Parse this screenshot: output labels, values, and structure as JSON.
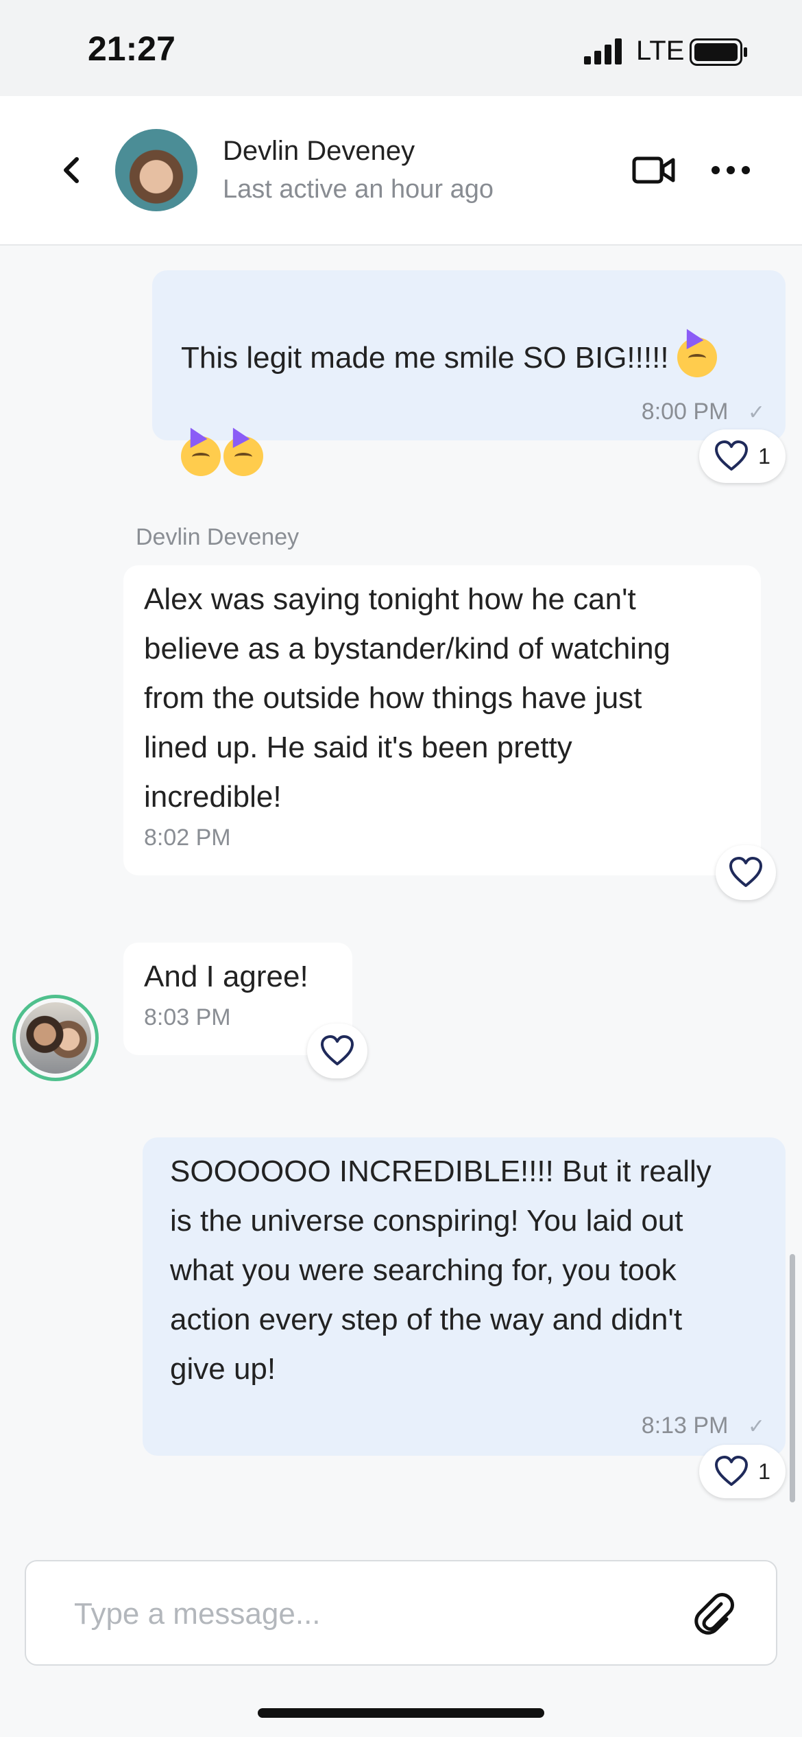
{
  "status_bar": {
    "time": "21:27",
    "network": "LTE"
  },
  "header": {
    "back_icon": "chevron-left-icon",
    "contact_name": "Devlin Deveney",
    "last_active": "Last active an hour ago",
    "video_icon": "video-camera-icon",
    "more_icon": "more-horizontal-icon"
  },
  "messages": [
    {
      "direction": "outgoing",
      "text": "This legit made me smile SO BIG!!!!! ",
      "emoji": "partying-face-emoji",
      "time": "8:00 PM",
      "read_icon": "check-icon",
      "likes": "1"
    },
    {
      "direction": "incoming",
      "sender": "Devlin Deveney",
      "text": "Alex was saying tonight how he can't\nbelieve as a bystander/kind of watching\nfrom the outside how things have just\nlined up. He said it's been pretty\nincredible!",
      "time": "8:02 PM"
    },
    {
      "direction": "incoming",
      "text": "And I agree!",
      "time": "8:03 PM"
    },
    {
      "direction": "outgoing",
      "text": "SOOOOOO INCREDIBLE!!!! But it really\nis the universe conspiring! You laid out\nwhat you were searching for, you took\naction every step of the way and didn't\ngive up!",
      "time": "8:13 PM",
      "read_icon": "check-icon",
      "likes": "1"
    }
  ],
  "composer": {
    "placeholder": "Type a message...",
    "value": "",
    "attach_icon": "paperclip-icon"
  },
  "colors": {
    "outgoing_bubble": "#e8f0fb",
    "incoming_bubble": "#ffffff",
    "heart_stroke": "#1f2a5a",
    "avatar_ring": "#4fc08d"
  }
}
